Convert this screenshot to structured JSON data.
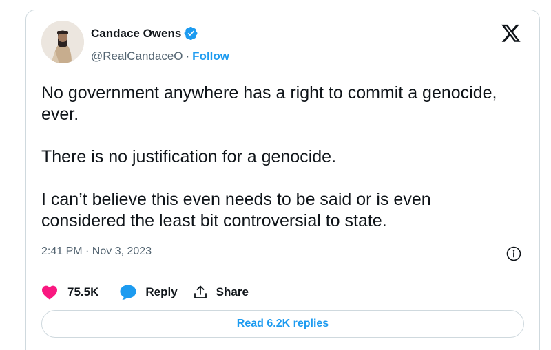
{
  "author": {
    "name": "Candace Owens",
    "handle": "@RealCandaceO",
    "separator": "·",
    "follow_label": "Follow",
    "verified": true,
    "avatar": "profile-photo"
  },
  "tweet": {
    "paragraphs": [
      "No government anywhere has a right to commit a genocide, ever.",
      "There is no justification for a genocide.",
      "I can’t believe this even needs to be said or is even considered the least bit controversial to state."
    ],
    "timestamp": "2:41 PM · Nov 3, 2023"
  },
  "actions": {
    "likes": "75.5K",
    "reply_label": "Reply",
    "share_label": "Share"
  },
  "read_replies_label": "Read 6.2K replies",
  "icons": {
    "platform_logo": "x-logo-icon",
    "verified": "verified-badge-icon",
    "info": "info-icon",
    "like": "heart-icon",
    "reply": "reply-bubble-icon",
    "share": "share-icon"
  },
  "colors": {
    "accent": "#1d9bf0",
    "like": "#f91880",
    "text": "#0f1419",
    "muted": "#536471",
    "border": "#cfd9de"
  }
}
